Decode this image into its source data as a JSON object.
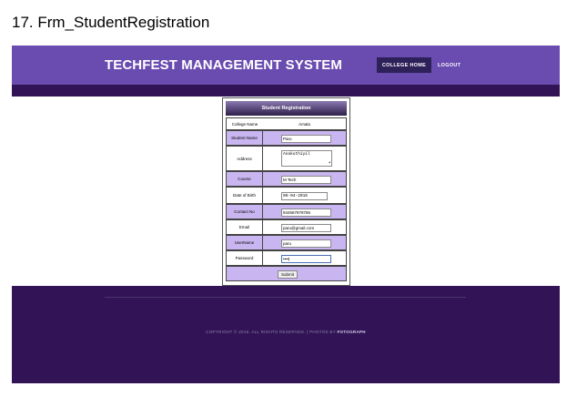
{
  "doc_heading": "17. Frm_StudentRegistration",
  "header": {
    "brand": "TECHFEST MANAGEMENT SYSTEM",
    "nav": {
      "home": "COLLEGE HOME",
      "logout": "LOGOUT"
    }
  },
  "form": {
    "title": "Student Registration",
    "college_name": {
      "label": "College Name",
      "value": "Amala"
    },
    "student_name": {
      "label": "Student Name",
      "value": "Paru"
    },
    "address": {
      "label": "Address",
      "value": "Anakuthiyil"
    },
    "course": {
      "label": "Course",
      "value": "M Tech"
    },
    "dob": {
      "label": "Date of Birth",
      "value": "06-04-2016"
    },
    "contact": {
      "label": "Contact No",
      "value": "944567878766"
    },
    "email": {
      "label": "Email",
      "value": "paru@gmail.com"
    },
    "username": {
      "label": "UserName",
      "value": "paru"
    },
    "password": {
      "label": "Password",
      "value": "••••|"
    },
    "submit": "Submit"
  },
  "footer": {
    "copyright": "COPYRIGHT © 2016. ALL RIGHTS RESERVED. | PHOTOS BY",
    "photos_by": "FOTOGRAPH"
  },
  "colors": {
    "header_bg": "#6a4bb0",
    "dark_bg": "#321456",
    "row_alt": "#c9b6f0"
  }
}
